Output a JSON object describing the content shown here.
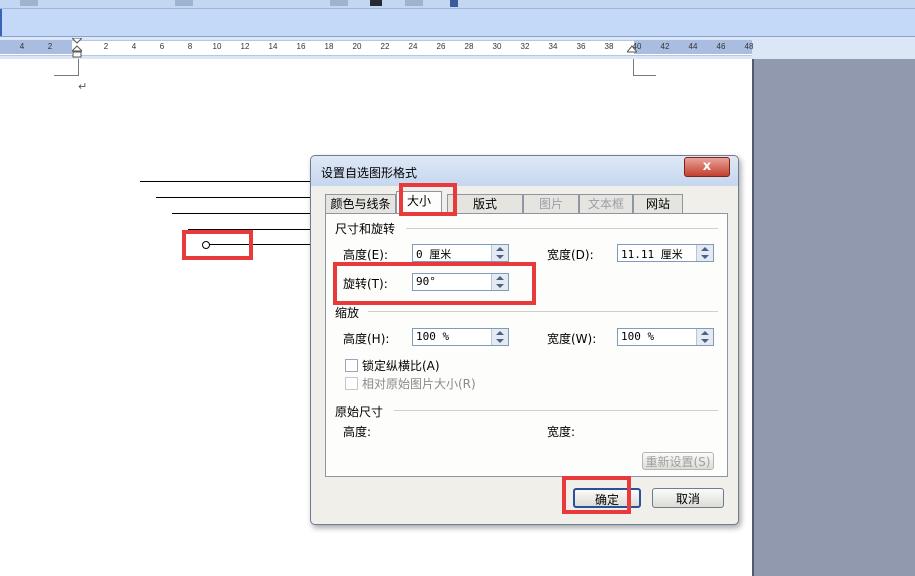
{
  "ruler": {
    "ticks": [
      "4",
      "2",
      "2",
      "4",
      "6",
      "8",
      "10",
      "12",
      "14",
      "16",
      "18",
      "20",
      "22",
      "24",
      "26",
      "28",
      "30",
      "32",
      "34",
      "36",
      "38",
      "40",
      "42",
      "44",
      "46",
      "48"
    ]
  },
  "document": {
    "paragraph_mark": "↵"
  },
  "dialog": {
    "title": "设置自选图形格式",
    "close_label": "x",
    "tabs": [
      {
        "label": "颜色与线条",
        "state": "normal"
      },
      {
        "label": "大小",
        "state": "active"
      },
      {
        "label": "版式",
        "state": "normal"
      },
      {
        "label": "图片",
        "state": "disabled"
      },
      {
        "label": "文本框",
        "state": "disabled"
      },
      {
        "label": "网站",
        "state": "normal"
      }
    ],
    "size_rotate": {
      "heading": "尺寸和旋转",
      "height_label": "高度(E):",
      "height_value": "0 厘米",
      "width_label": "宽度(D):",
      "width_value": "11.11 厘米",
      "rotate_label": "旋转(T):",
      "rotate_value": "90°"
    },
    "scale": {
      "heading": "缩放",
      "height_label": "高度(H):",
      "height_value": "100 %",
      "width_label": "宽度(W):",
      "width_value": "100 %",
      "lock_aspect_label": "锁定纵横比(A)",
      "relative_label": "相对原始图片大小(R)"
    },
    "original": {
      "heading": "原始尺寸",
      "height_label": "高度:",
      "width_label": "宽度:",
      "reset_label": "重新设置(S)"
    },
    "ok_label": "确定",
    "cancel_label": "取消"
  },
  "colors": {
    "highlight": "#e83a3a",
    "toolbar": "#c3d9f7",
    "dialog_bg": "#f0efe9"
  }
}
